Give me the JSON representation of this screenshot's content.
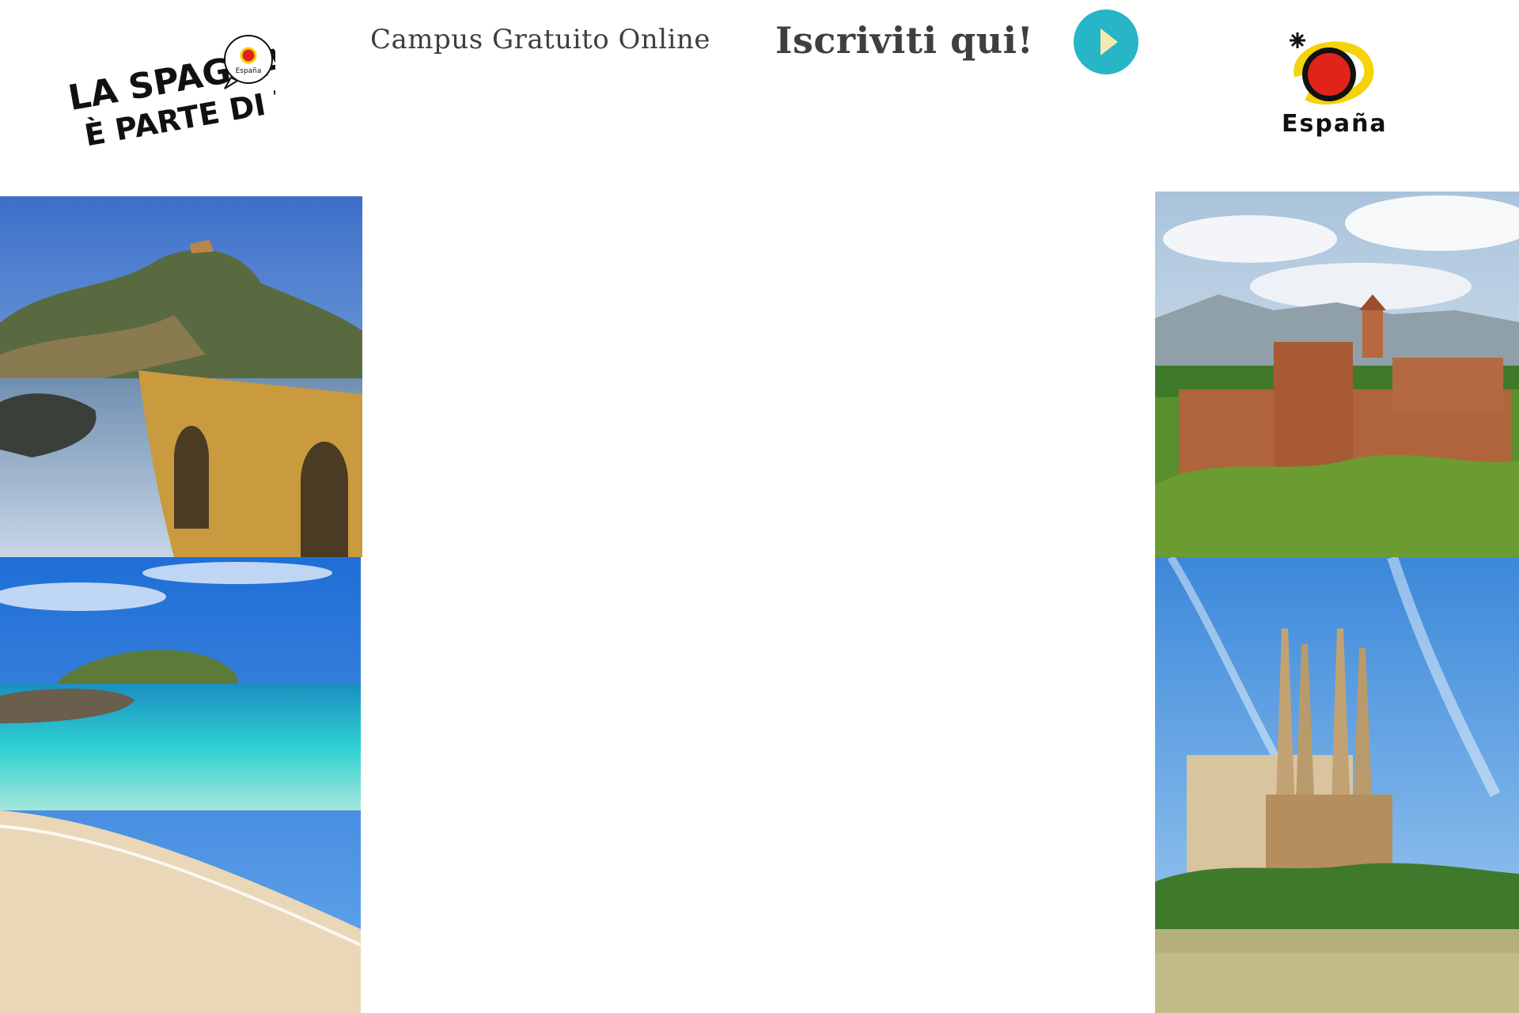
{
  "header": {
    "logo_left": {
      "line1": "LA SPAGNA",
      "line2": "È PARTE DI TE",
      "badge": "España",
      "icon": "spain-brand-icon"
    },
    "campus_label": "Campus Gratuito Online",
    "cta_label": "Iscriviti qui!",
    "play_button": {
      "icon": "play-icon",
      "color": "#27b5c7"
    },
    "logo_right": {
      "text": "España",
      "icon": "spain-sun-logo"
    }
  },
  "photos": [
    {
      "subject": "coastal-hermitage-stone-bridge"
    },
    {
      "subject": "alhambra-fortress"
    },
    {
      "subject": "turquoise-beach-island"
    },
    {
      "subject": "sagrada-familia-cathedral"
    }
  ],
  "colors": {
    "accent": "#27b5c7",
    "brand_red": "#e2231a",
    "brand_yellow": "#f5d20a",
    "text": "#3f3f3f"
  }
}
